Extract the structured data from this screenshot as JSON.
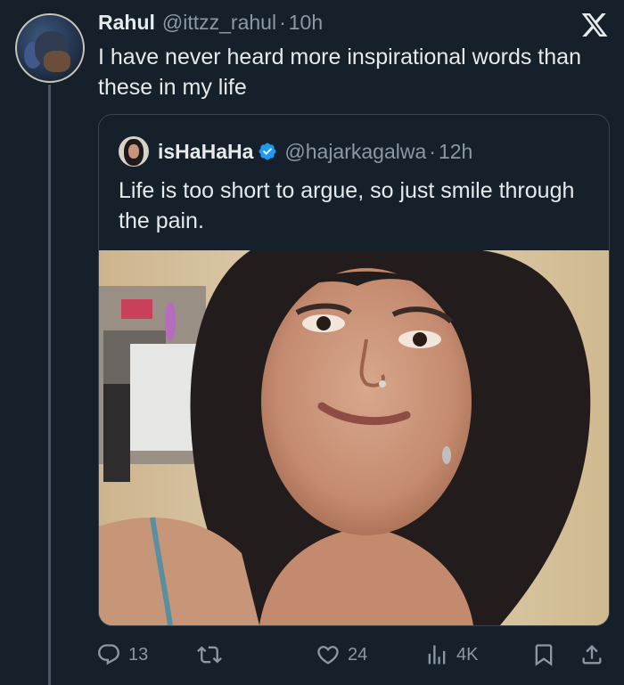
{
  "tweet": {
    "author_name": "Rahul",
    "author_handle": "@ittzz_rahul",
    "separator": "·",
    "time": "10h",
    "text": "I have never heard more inspirational words than these in my life"
  },
  "quote": {
    "author_name": "isHaHaHa",
    "author_handle": "@hajarkagalwa",
    "separator": "·",
    "time": "12h",
    "verified": true,
    "text": "Life is too short to argue, so just smile through the pain."
  },
  "actions": {
    "replies": "13",
    "likes": "24",
    "views": "4K"
  },
  "icons": {
    "brand": "x-logo-icon",
    "verified": "verified-badge-icon",
    "reply": "reply-icon",
    "retweet": "retweet-icon",
    "like": "heart-icon",
    "views": "views-icon",
    "bookmark": "bookmark-icon",
    "share": "share-icon"
  },
  "colors": {
    "background": "#15202b",
    "text": "#e7e9ea",
    "secondary_text": "#8b98a5",
    "verified": "#1d9bf0",
    "border": "#38444d"
  }
}
